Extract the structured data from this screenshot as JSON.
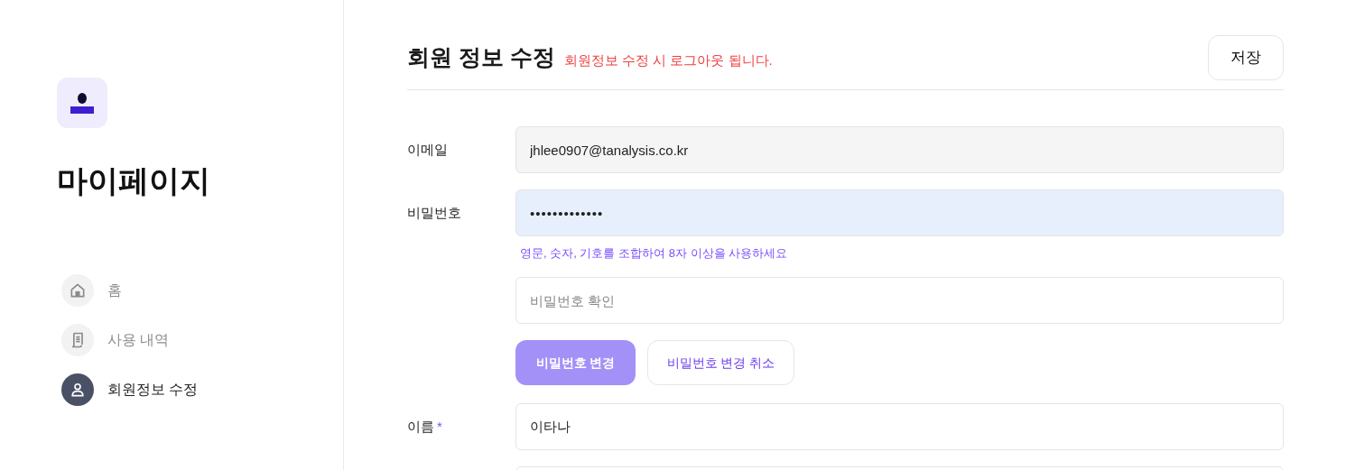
{
  "sidebar": {
    "title": "마이페이지",
    "nav": [
      {
        "label": "홈",
        "selected": false
      },
      {
        "label": "사용 내역",
        "selected": false
      },
      {
        "label": "회원정보 수정",
        "selected": true
      }
    ]
  },
  "header": {
    "title": "회원 정보 수정",
    "notice": "회원정보 수정 시 로그아웃 됩니다.",
    "save_button": "저장"
  },
  "form": {
    "rows": [
      {
        "kind": "readonly_field",
        "label": "이메일",
        "value": "jhlee0907@tanalysis.co.kr"
      },
      {
        "kind": "autofilled_field",
        "label": "비밀번호",
        "value": "•••••••••••••"
      },
      {
        "kind": "hint",
        "text": "영문, 숫자, 기호를 조합하여 8자 이상을 사용하세요"
      },
      {
        "kind": "field",
        "placeholder": "비밀번호 확인"
      },
      {
        "kind": "buttons",
        "buttons": [
          {
            "label": "비밀번호 변경",
            "primary": true
          },
          {
            "label": "비밀번호 변경 취소",
            "primary": false
          }
        ]
      },
      {
        "kind": "field",
        "label": "이름",
        "required_mark": "*",
        "value": "이타나"
      },
      {
        "kind": "field"
      }
    ]
  }
}
